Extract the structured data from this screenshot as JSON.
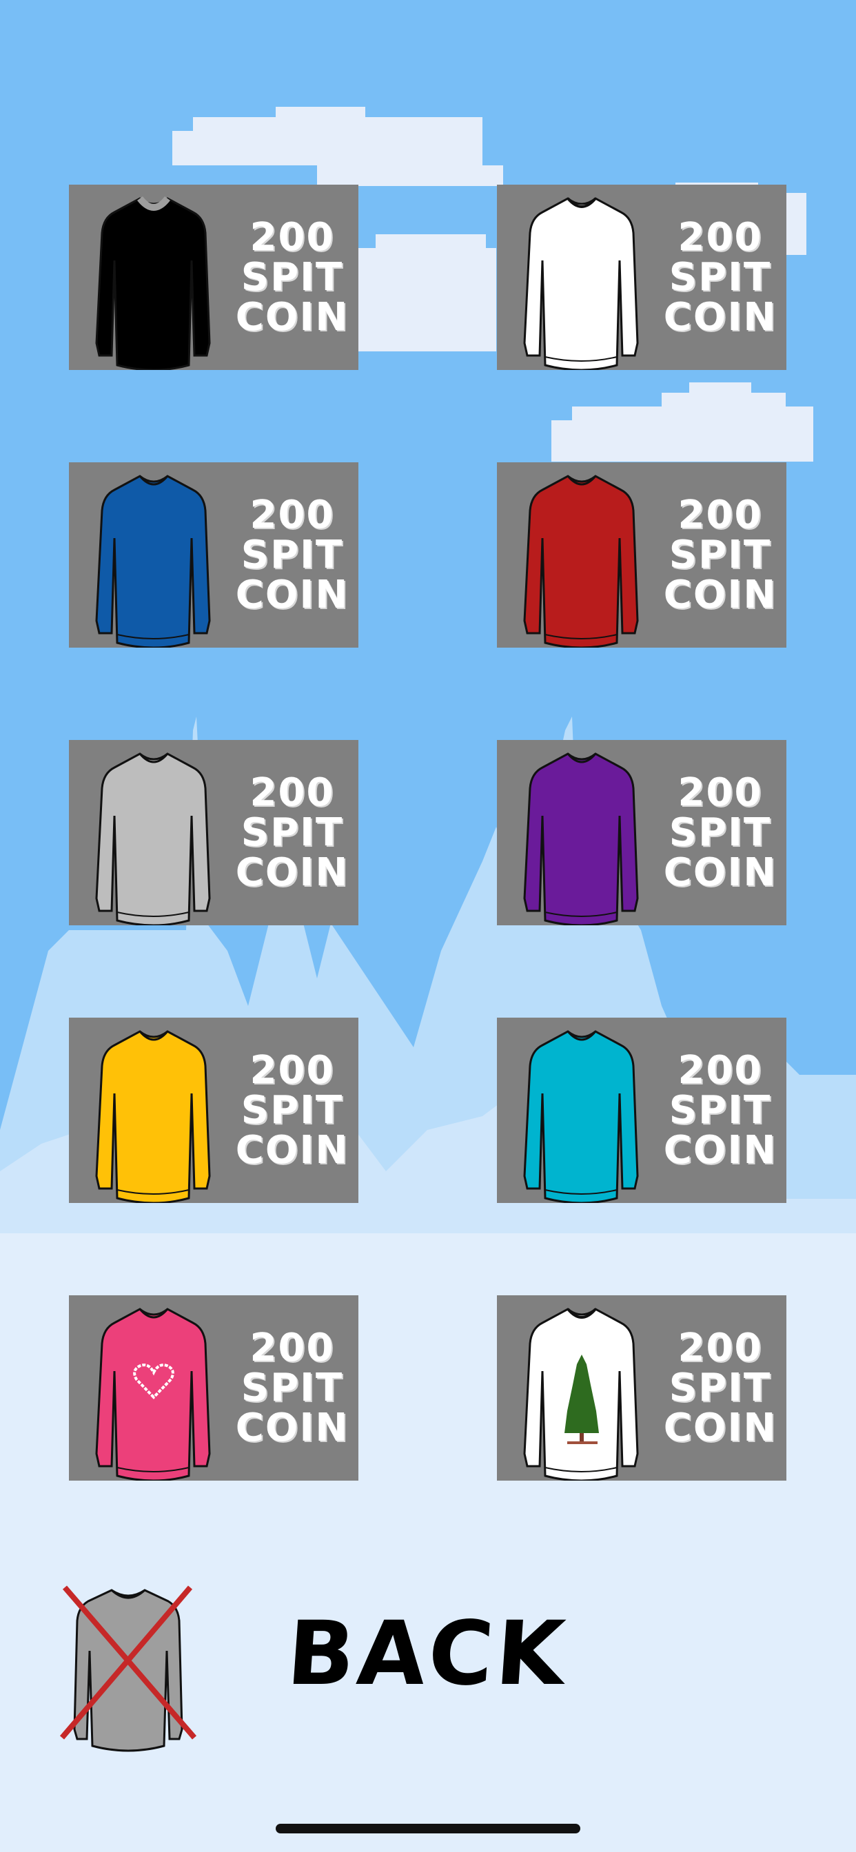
{
  "shop": {
    "items": [
      {
        "price_value": "200",
        "currency_line1": "SPIT",
        "currency_line2": "COIN",
        "sweater": "black-sweater-icon",
        "color": "#000000",
        "collar": "#9e9e9e"
      },
      {
        "price_value": "200",
        "currency_line1": "SPIT",
        "currency_line2": "COIN",
        "sweater": "white-sweater-icon",
        "color": "#ffffff",
        "collar": "#111111"
      },
      {
        "price_value": "200",
        "currency_line1": "SPIT",
        "currency_line2": "COIN",
        "sweater": "blue-sweater-icon",
        "color": "#0f5aa8",
        "collar": "#0f5aa8"
      },
      {
        "price_value": "200",
        "currency_line1": "SPIT",
        "currency_line2": "COIN",
        "sweater": "red-sweater-icon",
        "color": "#b81c1c",
        "collar": "#b81c1c"
      },
      {
        "price_value": "200",
        "currency_line1": "SPIT",
        "currency_line2": "COIN",
        "sweater": "grey-sweater-icon",
        "color": "#bdbdbd",
        "collar": "#bdbdbd"
      },
      {
        "price_value": "200",
        "currency_line1": "SPIT",
        "currency_line2": "COIN",
        "sweater": "purple-sweater-icon",
        "color": "#6a1b9a",
        "collar": "#6a1b9a"
      },
      {
        "price_value": "200",
        "currency_line1": "SPIT",
        "currency_line2": "COIN",
        "sweater": "yellow-sweater-icon",
        "color": "#ffc107",
        "collar": "#ffc107"
      },
      {
        "price_value": "200",
        "currency_line1": "SPIT",
        "currency_line2": "COIN",
        "sweater": "cyan-sweater-icon",
        "color": "#00b4cf",
        "collar": "#00b4cf"
      },
      {
        "price_value": "200",
        "currency_line1": "SPIT",
        "currency_line2": "COIN",
        "sweater": "pink-heart-sweater-icon",
        "color": "#ec407a",
        "collar": "#ec407a"
      },
      {
        "price_value": "200",
        "currency_line1": "SPIT",
        "currency_line2": "COIN",
        "sweater": "white-tree-sweater-icon",
        "color": "#ffffff",
        "collar": "#111111"
      }
    ]
  },
  "footer": {
    "no_sweater_icon": "no-sweater-icon",
    "back_label": "BACK"
  },
  "colors": {
    "sky": "#78bef6",
    "cloud": "#e6eefa",
    "mountain": "#b9ddfa",
    "snow": "#e1eefc",
    "card_bg": "#808080",
    "cross": "#c62828"
  }
}
